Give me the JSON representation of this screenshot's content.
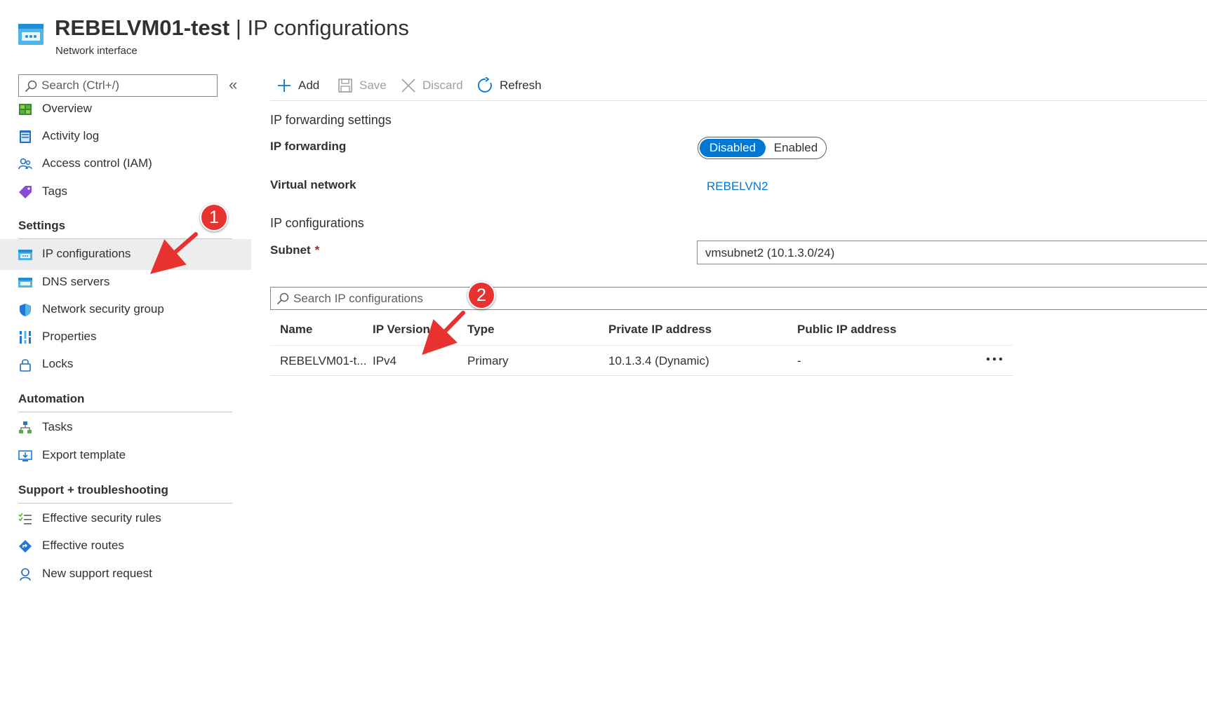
{
  "header": {
    "resource_name": "REBELVM01-test",
    "separator": "|",
    "blade_title": "IP configurations",
    "subtitle": "Network interface"
  },
  "sidebar": {
    "search_placeholder": "Search (Ctrl+/)",
    "collapse_glyph": "«",
    "items": [
      {
        "label": "Overview",
        "icon": "overview-icon"
      },
      {
        "label": "Activity log",
        "icon": "activity-log-icon"
      },
      {
        "label": "Access control (IAM)",
        "icon": "access-control-icon"
      },
      {
        "label": "Tags",
        "icon": "tag-icon"
      }
    ],
    "groups": [
      {
        "title": "Settings",
        "items": [
          {
            "label": "IP configurations",
            "icon": "ip-configurations-icon",
            "active": true
          },
          {
            "label": "DNS servers",
            "icon": "dns-servers-icon"
          },
          {
            "label": "Network security group",
            "icon": "shield-icon"
          },
          {
            "label": "Properties",
            "icon": "properties-icon"
          },
          {
            "label": "Locks",
            "icon": "lock-icon"
          }
        ]
      },
      {
        "title": "Automation",
        "items": [
          {
            "label": "Tasks",
            "icon": "tasks-icon"
          },
          {
            "label": "Export template",
            "icon": "export-template-icon"
          }
        ]
      },
      {
        "title": "Support + troubleshooting",
        "items": [
          {
            "label": "Effective security rules",
            "icon": "security-rules-icon"
          },
          {
            "label": "Effective routes",
            "icon": "routes-icon"
          },
          {
            "label": "New support request",
            "icon": "support-request-icon"
          }
        ]
      }
    ]
  },
  "toolbar": {
    "add": "Add",
    "save": "Save",
    "discard": "Discard",
    "refresh": "Refresh"
  },
  "main": {
    "forwarding_section": "IP forwarding settings",
    "ip_forwarding_label": "IP forwarding",
    "toggle": {
      "disabled": "Disabled",
      "enabled": "Enabled",
      "selected": "Disabled"
    },
    "virtual_network_label": "Virtual network",
    "virtual_network_value": "REBELVN2",
    "ipconfig_section": "IP configurations",
    "subnet_label": "Subnet",
    "required_mark": "*",
    "subnet_value": "vmsubnet2 (10.1.3.0/24)",
    "ip_search_placeholder": "Search IP configurations",
    "table": {
      "columns": [
        "Name",
        "IP Version",
        "Type",
        "Private IP address",
        "Public IP address"
      ],
      "rows": [
        {
          "name": "REBELVM01-t...",
          "ip_version": "IPv4",
          "type": "Primary",
          "private_ip": "10.1.3.4 (Dynamic)",
          "public_ip": "-"
        }
      ]
    }
  },
  "callouts": {
    "one": "1",
    "two": "2"
  },
  "colors": {
    "accent": "#0078d4",
    "callout": "#e8322f",
    "active_nav": "#ededed"
  }
}
